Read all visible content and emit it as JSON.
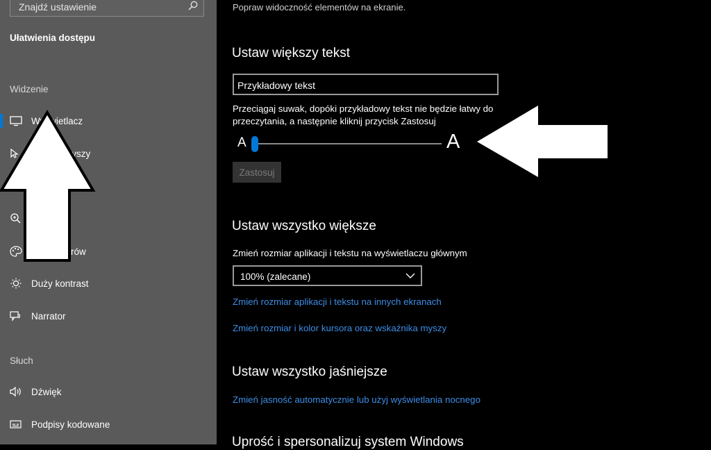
{
  "sidebar": {
    "search_placeholder": "Znajdź ustawienie",
    "title": "Ułatwienia dostępu",
    "group_vision": "Widzenie",
    "group_hearing": "Słuch",
    "items": [
      {
        "label": "Wyświetlacz",
        "icon": "monitor-icon"
      },
      {
        "label": "myszy",
        "icon": "mouse-pointer-icon"
      },
      {
        "label": "",
        "icon": "magnifier-icon"
      },
      {
        "label": "rów",
        "icon": "palette-icon"
      },
      {
        "label": "Duży kontrast",
        "icon": "brightness-icon"
      },
      {
        "label": "Narrator",
        "icon": "narrator-icon"
      },
      {
        "label": "Dźwięk",
        "icon": "speaker-icon"
      },
      {
        "label": "Podpisy kodowane",
        "icon": "captions-icon"
      }
    ]
  },
  "main": {
    "subtitle": "Popraw widoczność elementów na ekranie.",
    "section1": {
      "heading": "Ustaw większy tekst",
      "sample_text": "Przykładowy tekst",
      "description_line1": "Przeciągaj suwak, dopóki przykładowy tekst nie będzie łatwy do",
      "description_line2": "przeczytania, a następnie kliknij przycisk Zastosuj",
      "slider_min_label": "A",
      "slider_max_label": "A",
      "slider_value_fraction": 0.0,
      "apply_label": "Zastosuj"
    },
    "section2": {
      "heading": "Ustaw wszystko większe",
      "scale_label": "Zmień rozmiar aplikacji i tekstu na wyświetlaczu głównym",
      "scale_value": "100% (zalecane)",
      "link1": "Zmień rozmiar aplikacji i tekstu na innych ekranach",
      "link2": "Zmień rozmiar i kolor kursora oraz wskaźnika myszy"
    },
    "section3": {
      "heading": "Ustaw wszystko jaśniejsze",
      "link1": "Zmień jasność automatycznie lub użyj wyświetlania nocnego"
    },
    "section4": {
      "heading": "Uprość i spersonalizuj system Windows"
    }
  },
  "colors": {
    "accent": "#0078d7",
    "link": "#3d8ee6",
    "sidebar_bg": "#5a5a5a",
    "main_bg": "#000000"
  }
}
